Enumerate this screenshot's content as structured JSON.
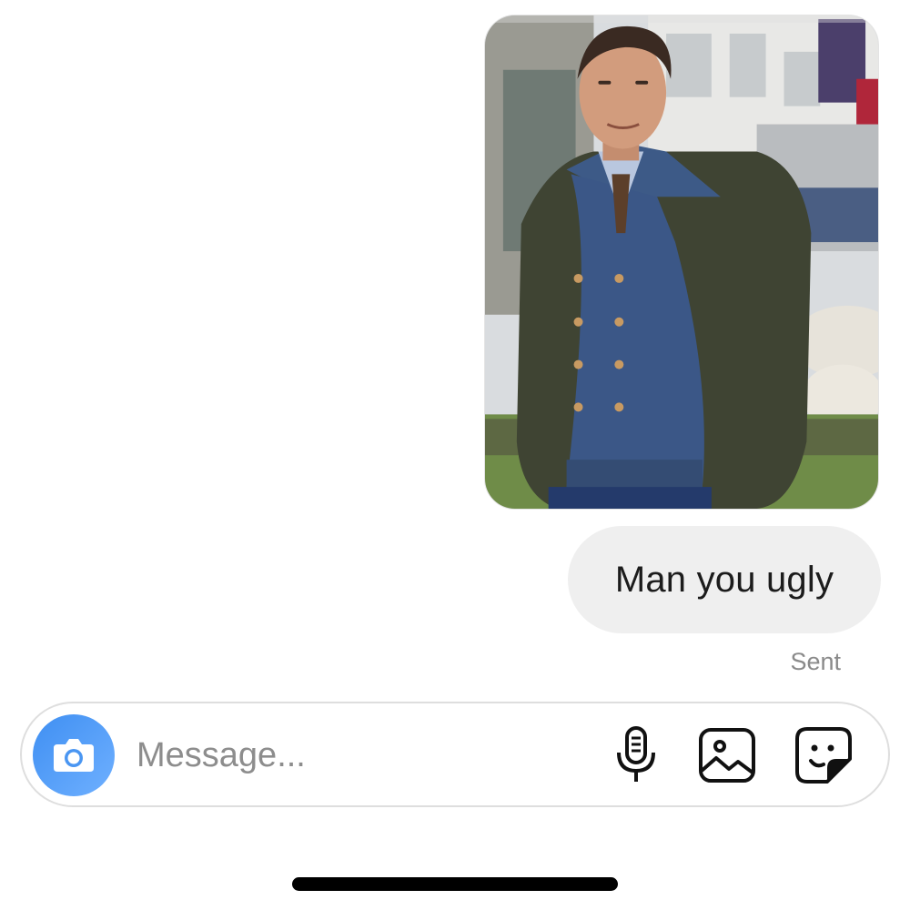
{
  "thread": {
    "messages": [
      {
        "type": "photo",
        "direction": "outgoing",
        "alt": "shared-photo"
      },
      {
        "type": "text",
        "direction": "outgoing",
        "text": "Man you ugly"
      }
    ],
    "status": "Sent"
  },
  "composer": {
    "placeholder": "Message...",
    "value": "",
    "icons": {
      "camera": "camera-icon",
      "mic": "microphone-icon",
      "gallery": "gallery-icon",
      "sticker": "sticker-icon"
    },
    "accent": "#3f8ff2"
  }
}
